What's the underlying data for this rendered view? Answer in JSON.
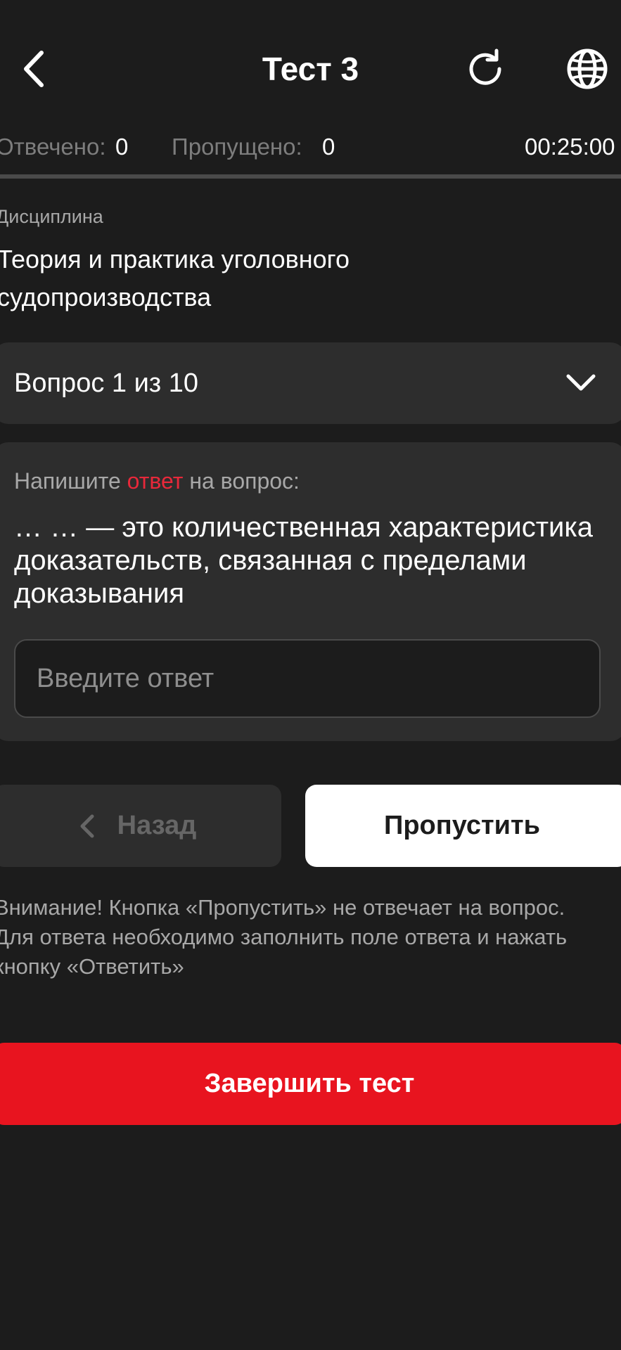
{
  "header": {
    "title": "Тест 3",
    "back_icon": "chevron-left-icon",
    "refresh_icon": "refresh-icon",
    "language_icon": "globe-icon"
  },
  "status": {
    "answered_label": "Отвечено:",
    "answered_value": "0",
    "skipped_label": "Пропущено:",
    "skipped_value": "0",
    "timer": "00:25:00"
  },
  "discipline": {
    "label": "Дисциплина",
    "name": "Теория и практика уголовного судопроизводства"
  },
  "question_selector": {
    "label": "Вопрос 1 из 10"
  },
  "question": {
    "prompt_before": "Напишите ",
    "prompt_accent": "ответ",
    "prompt_after": " на вопрос:",
    "text": "… … — это количественная характеристика доказательств, связанная с пределами доказывания",
    "input_placeholder": "Введите ответ",
    "input_value": ""
  },
  "nav": {
    "back_label": "Назад",
    "skip_label": "Пропустить"
  },
  "warning": "Внимание! Кнопка «Пропустить» не отвечает на вопрос. Для ответа необходимо заполнить поле ответа и нажать кнопку «Ответить»",
  "finish_label": "Завершить тест",
  "colors": {
    "background": "#1c1c1c",
    "card": "#2d2d2d",
    "accent_red": "#e8141f",
    "prompt_accent": "#e8283a",
    "muted_text": "#a8a8a8"
  }
}
